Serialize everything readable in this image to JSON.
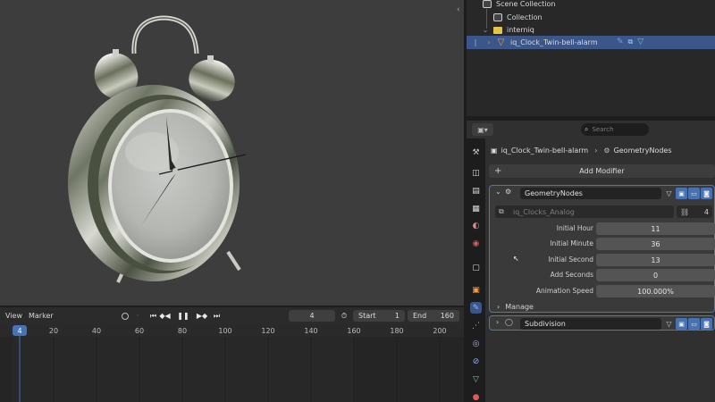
{
  "outliner": {
    "rows": [
      {
        "label": "Scene Collection"
      },
      {
        "label": "Collection"
      },
      {
        "label": "interniq"
      },
      {
        "label": "iq_Clock_Twin-bell-alarm"
      }
    ]
  },
  "properties": {
    "search_placeholder": "Search",
    "context": {
      "object": "iq_Clock_Twin-bell-alarm",
      "modifier": "GeometryNodes"
    },
    "add_modifier_label": "Add Modifier",
    "modifiers": [
      {
        "name": "GeometryNodes",
        "node_group": "iq_Clocks_Analog",
        "node_group_users": "4",
        "inputs": [
          {
            "label": "Initial Hour",
            "value": "11"
          },
          {
            "label": "Initial Minute",
            "value": "36"
          },
          {
            "label": "Initial Second",
            "value": "13"
          },
          {
            "label": "Add Seconds",
            "value": "0"
          },
          {
            "label": "Animation Speed",
            "value": "100.000%"
          }
        ],
        "manage_label": "Manage"
      },
      {
        "name": "Subdivision"
      }
    ]
  },
  "timeline": {
    "menus": [
      "View",
      "Marker"
    ],
    "current_frame": "4",
    "start_label": "Start",
    "start_value": "1",
    "end_label": "End",
    "end_value": "160",
    "ruler_ticks": [
      "20",
      "40",
      "60",
      "80",
      "100",
      "120",
      "140",
      "160",
      "180",
      "200"
    ],
    "playhead_label": "4"
  },
  "colors": {
    "selection": "#3b5689",
    "accent": "#4772b3",
    "object_orange": "#ff9a3a",
    "playhead": "#4772b3"
  },
  "icons": {
    "outliner_tail": [
      "wrench-icon",
      "nodes-icon",
      "mesh-icon"
    ],
    "modifier_buttons": [
      "edit-mode-icon",
      "viewport-icon",
      "render-icon"
    ],
    "property_tabs": [
      "tool-icon",
      "render-icon",
      "output-icon",
      "view-layer-icon",
      "scene-icon",
      "world-icon",
      "collection-icon",
      "object-icon",
      "modifier-icon",
      "particles-icon",
      "physics-icon",
      "constraints-icon",
      "data-icon",
      "material-icon"
    ]
  }
}
